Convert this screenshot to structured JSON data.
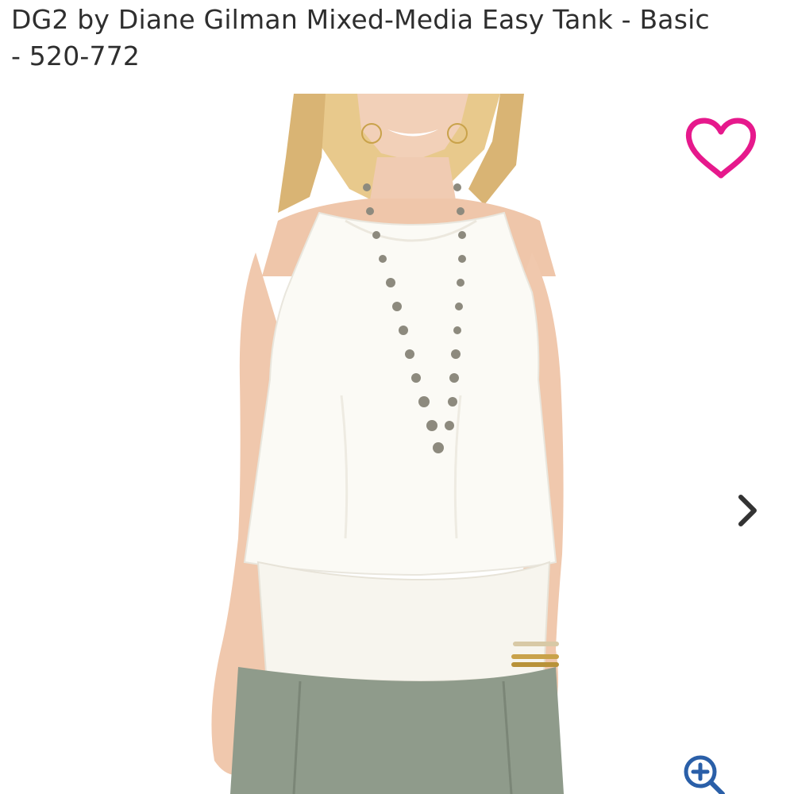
{
  "product": {
    "title_line1": "DG2 by Diane Gilman Mixed-Media Easy Tank - Basic",
    "title_line2": "- 520-772"
  },
  "icons": {
    "favorite": "heart-outline-icon",
    "next": "chevron-right-icon",
    "zoom": "zoom-in-icon"
  },
  "colors": {
    "accent": "#e6198c",
    "text": "#2e2e2e",
    "icon_dark": "#333333",
    "zoom_icon": "#2a5fa8"
  }
}
